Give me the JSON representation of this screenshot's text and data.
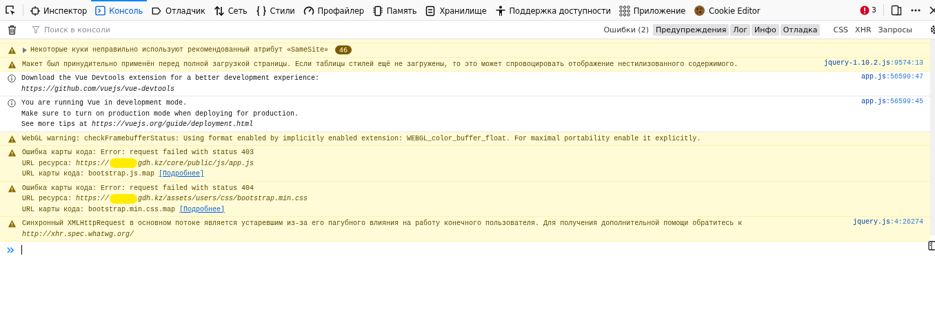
{
  "toolbar": {
    "tabs": [
      {
        "label": "Инспектор",
        "selected": false
      },
      {
        "label": "Консоль",
        "selected": true
      },
      {
        "label": "Отладчик",
        "selected": false
      },
      {
        "label": "Сеть",
        "selected": false
      },
      {
        "label": "Стили",
        "selected": false
      },
      {
        "label": "Профайлер",
        "selected": false
      },
      {
        "label": "Память",
        "selected": false
      },
      {
        "label": "Хранилище",
        "selected": false
      },
      {
        "label": "Поддержка доступности",
        "selected": false
      },
      {
        "label": "Приложение",
        "selected": false
      },
      {
        "label": "Cookie Editor",
        "selected": false
      }
    ],
    "error_count": "3"
  },
  "filter_bar": {
    "search": {
      "placeholder": "Поиск в консоли"
    },
    "levels": [
      {
        "label": "Ошибки (2)",
        "selected": false
      },
      {
        "label": "Предупреждения",
        "selected": true
      },
      {
        "label": "Лог",
        "selected": true
      },
      {
        "label": "Инфо",
        "selected": true
      },
      {
        "label": "Отладка",
        "selected": true
      }
    ],
    "types": [
      {
        "label": "CSS",
        "selected": false
      },
      {
        "label": "XHR",
        "selected": false
      },
      {
        "label": "Запросы",
        "selected": false
      }
    ]
  },
  "messages": [
    {
      "kind": "warning",
      "expandable": true,
      "count": "46",
      "lines": [
        [
          {
            "kind": "text",
            "text": "Некоторые куки неправильно используют рекомендованный атрибут «SameSite»"
          }
        ]
      ]
    },
    {
      "kind": "warning",
      "expandable": false,
      "source": "jquery-1.10.2.js",
      "location": ":9574:13",
      "lines": [
        [
          {
            "kind": "text",
            "text": "Макет был принудительно применён перед полной загрузкой страницы. Если таблицы стилей ещё не загружены, то это может спровоцировать отображение нестилизованного содержимого."
          }
        ]
      ]
    },
    {
      "kind": "info",
      "expandable": false,
      "source": "app.js",
      "location": ":56590:47",
      "lines": [
        [
          {
            "kind": "text",
            "text": "Download the Vue Devtools extension for a better development experience:"
          }
        ],
        [
          {
            "kind": "url",
            "text": "https://github.com/vuejs/vue-devtools"
          }
        ]
      ]
    },
    {
      "kind": "info",
      "expandable": false,
      "source": "app.js",
      "location": ":56599:45",
      "lines": [
        [
          {
            "kind": "text",
            "text": "You are running Vue in development mode."
          }
        ],
        [
          {
            "kind": "text",
            "text": "Make sure to turn on production mode when deploying for production."
          }
        ],
        [
          {
            "kind": "text",
            "text": "See more tips at "
          },
          {
            "kind": "url",
            "text": "https://vuejs.org/guide/deployment.html"
          }
        ]
      ]
    },
    {
      "kind": "warning",
      "expandable": false,
      "lines": [
        [
          {
            "kind": "text",
            "text": "WebGL warning: checkFramebufferStatus: Using format enabled by implicitly enabled extension: WEBGL_color_buffer_float. For maximal portability enable it explicitly."
          }
        ]
      ]
    },
    {
      "kind": "warning",
      "expandable": false,
      "lines": [
        [
          {
            "kind": "text",
            "text": "Ошибка карты кода: Error: request failed with status 403"
          }
        ],
        [
          {
            "kind": "text",
            "text": "URL ресурса: "
          },
          {
            "kind": "url",
            "text": "https://"
          },
          {
            "kind": "redaction"
          },
          {
            "kind": "url",
            "text": "gdh.kz/core/public/js/app.js"
          }
        ],
        [
          {
            "kind": "text",
            "text": "URL карты кода: bootstrap.js.map "
          },
          {
            "kind": "link",
            "text": "[Подробнее]"
          }
        ]
      ]
    },
    {
      "kind": "warning",
      "expandable": false,
      "lines": [
        [
          {
            "kind": "text",
            "text": "Ошибка карты кода: Error: request failed with status 404"
          }
        ],
        [
          {
            "kind": "text",
            "text": "URL ресурса: "
          },
          {
            "kind": "url",
            "text": "https://"
          },
          {
            "kind": "redaction"
          },
          {
            "kind": "url",
            "text": "gdh.kz/assets/users/css/bootstrap.min.css"
          }
        ],
        [
          {
            "kind": "text",
            "text": "URL карты кода: bootstrap.min.css.map "
          },
          {
            "kind": "link",
            "text": "[Подробнее]"
          }
        ]
      ]
    },
    {
      "kind": "warning",
      "expandable": false,
      "source": "jquery.js",
      "location": ":4:26274",
      "lines": [
        [
          {
            "kind": "text",
            "text": "Синхронный XMLHttpRequest в основном потоке является устаревшим из-за его пагубного влияния на работу конечного пользователя. Для получения дополнительной помощи обратитесь к"
          }
        ],
        [
          {
            "kind": "url",
            "text": "http://xhr.spec.whatwg.org/"
          }
        ]
      ]
    }
  ]
}
